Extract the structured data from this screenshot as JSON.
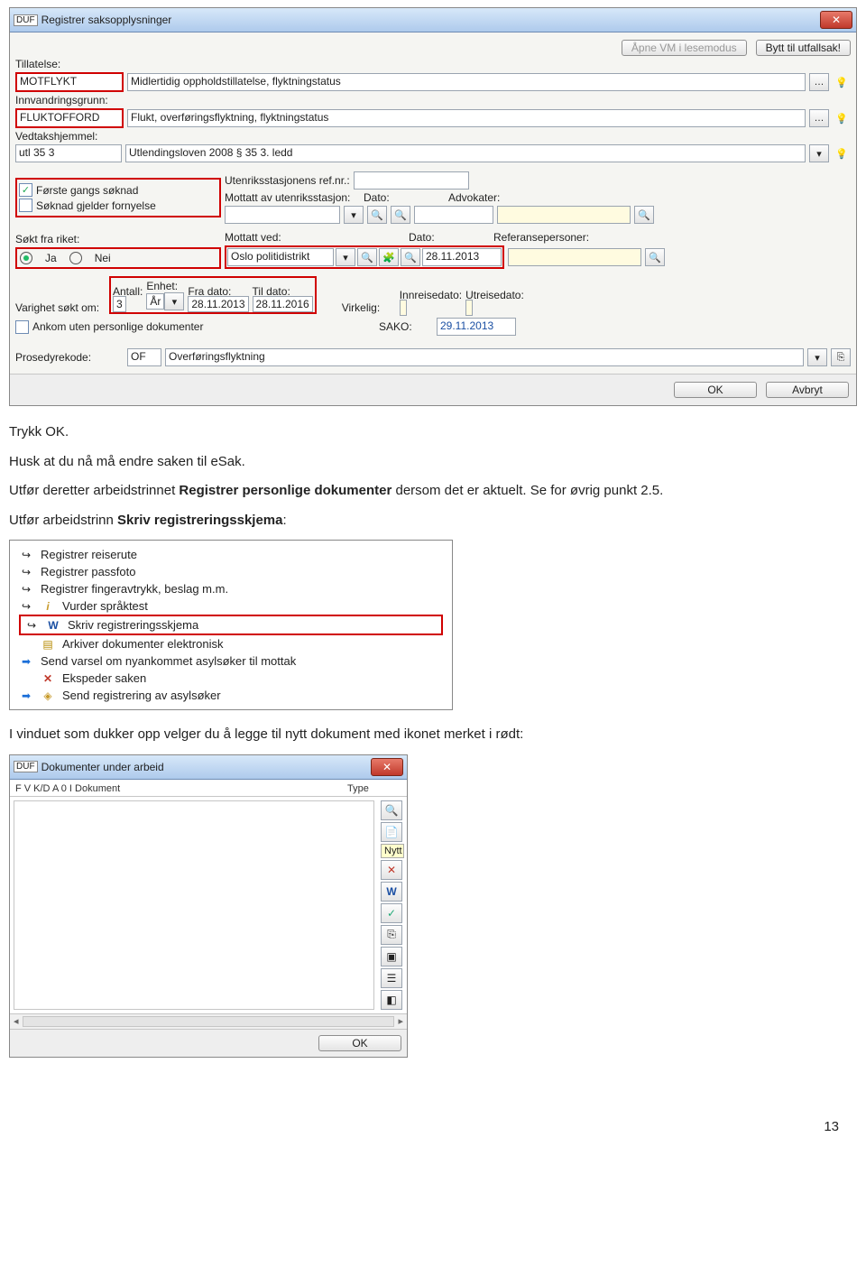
{
  "page_number": "13",
  "win1": {
    "title": "Registrer saksopplysninger",
    "btn_open": "Åpne VM i lesemodus",
    "btn_switch": "Bytt til utfallsak!",
    "tillatelse_lbl": "Tillatelse:",
    "tillatelse_code": "MOTFLYKT",
    "tillatelse_desc": "Midlertidig oppholdstillatelse, flyktningstatus",
    "innv_lbl": "Innvandringsgrunn:",
    "innv_code": "FLUKTOFFORD",
    "innv_desc": "Flukt, overføringsflyktning, flyktningstatus",
    "ved_lbl": "Vedtakshjemmel:",
    "ved_code": "utl 35 3",
    "ved_desc": "Utlendingsloven 2008 § 35 3. ledd",
    "forste": "Første gangs søknad",
    "fornyelse": "Søknad gjelder fornyelse",
    "utenriks_ref_lbl": "Utenriksstasjonens ref.nr.:",
    "mottatt_av_lbl": "Mottatt av utenriksstasjon:",
    "dato_lbl": "Dato:",
    "advokater_lbl": "Advokater:",
    "sokt_lbl": "Søkt fra riket:",
    "ja": "Ja",
    "nei": "Nei",
    "mottatt_ved_lbl": "Mottatt ved:",
    "mottatt_ved_val": "Oslo politidistrikt",
    "mottatt_dato": "28.11.2013",
    "refpers_lbl": "Referansepersoner:",
    "varighet_lbl": "Varighet søkt om:",
    "antall_lbl": "Antall:",
    "antall_val": "3",
    "enhet_lbl": "Enhet:",
    "enhet_val": "År",
    "fra_lbl": "Fra dato:",
    "fra_val": "28.11.2013",
    "til_lbl": "Til dato:",
    "til_val": "28.11.2016",
    "virkelig_lbl": "Virkelig:",
    "innreise_lbl": "Innreisedato:",
    "utreise_lbl": "Utreisedato:",
    "ankom_lbl": "Ankom uten personlige dokumenter",
    "sako_lbl": "SAKO:",
    "sako_val": "29.11.2013",
    "pros_lbl": "Prosedyrekode:",
    "pros_code": "OF",
    "pros_desc": "Overføringsflyktning",
    "ok": "OK",
    "avbryt": "Avbryt"
  },
  "text1": "Trykk OK.",
  "text2": "Husk at du nå må endre saken til eSak.",
  "text3a": "Utfør deretter arbeidstrinnet ",
  "text3b": "Registrer personlige dokumenter",
  "text3c": " dersom det er aktuelt. Se for øvrig punkt 2.5.",
  "text4a": "Utfør arbeidstrinn ",
  "text4b": "Skriv registreringsskjema",
  "text4c": ":",
  "list": {
    "i0": "Registrer reiserute",
    "i1": "Registrer passfoto",
    "i2": "Registrer fingeravtrykk, beslag m.m.",
    "i3": "Vurder språktest",
    "i4": "Skriv registreringsskjema",
    "i5": "Arkiver dokumenter elektronisk",
    "i6": "Send varsel om nyankommet asylsøker til mottak",
    "i7": "Ekspeder saken",
    "i8": "Send registrering av asylsøker"
  },
  "text5": "I vinduet som dukker opp velger du å legge til nytt dokument med ikonet merket i rødt:",
  "win3": {
    "title": "Dokumenter under arbeid",
    "cols": "F   V  K/D  A    0    I  Dokument",
    "type": "Type",
    "tooltip": "Nytt",
    "ok": "OK"
  }
}
